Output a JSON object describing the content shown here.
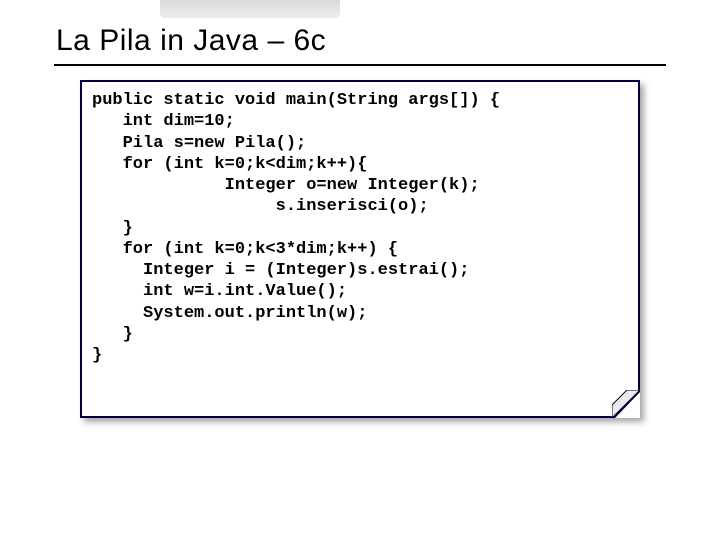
{
  "slide": {
    "title": "La Pila in Java – 6c",
    "code_lines": [
      "public static void main(String args[]) {",
      "   int dim=10;",
      "   Pila s=new Pila();",
      "   for (int k=0;k<dim;k++){",
      "             Integer o=new Integer(k);",
      "                  s.inserisci(o);",
      "   }",
      "   for (int k=0;k<3*dim;k++) {",
      "     Integer i = (Integer)s.estrai();",
      "     int w=i.int.Value();",
      "     System.out.println(w);",
      "   }",
      "}"
    ]
  }
}
